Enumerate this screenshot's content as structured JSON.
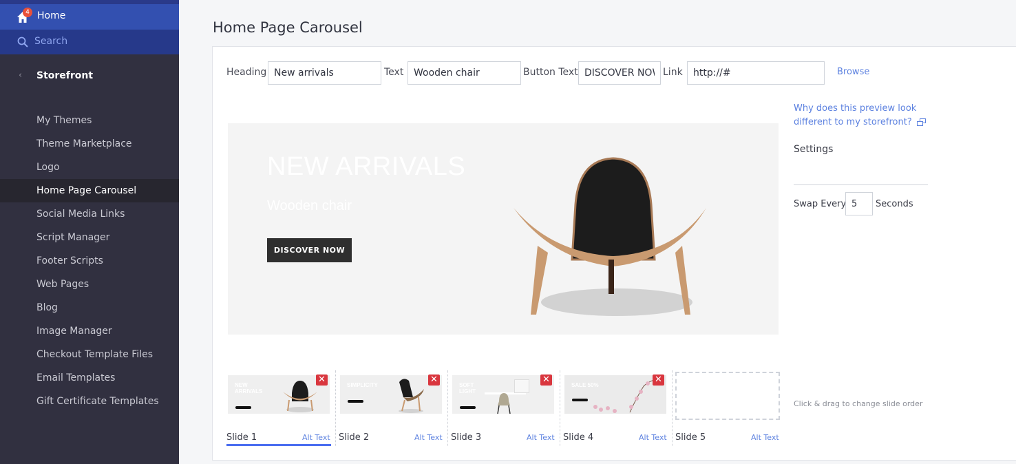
{
  "sidebar": {
    "home": {
      "label": "Home",
      "badge": "4",
      "icon": "home-icon"
    },
    "search": {
      "label": "Search",
      "icon": "search-icon"
    },
    "section": {
      "label": "Storefront",
      "icon": "chevron-left-icon"
    },
    "items": [
      {
        "label": "My Themes"
      },
      {
        "label": "Theme Marketplace"
      },
      {
        "label": "Logo"
      },
      {
        "label": "Home Page Carousel",
        "active": true
      },
      {
        "label": "Social Media Links"
      },
      {
        "label": "Script Manager"
      },
      {
        "label": "Footer Scripts"
      },
      {
        "label": "Web Pages"
      },
      {
        "label": "Blog"
      },
      {
        "label": "Image Manager"
      },
      {
        "label": "Checkout Template Files"
      },
      {
        "label": "Email Templates"
      },
      {
        "label": "Gift Certificate Templates"
      }
    ]
  },
  "page": {
    "title": "Home Page Carousel"
  },
  "form": {
    "heading_label": "Heading",
    "heading_value": "New arrivals",
    "text_label": "Text",
    "text_value": "Wooden chair",
    "button_text_label": "Button Text",
    "button_text_value": "DISCOVER NOW",
    "link_label": "Link",
    "link_value": "http://#",
    "browse_label": "Browse"
  },
  "preview": {
    "heading": "NEW ARRIVALS",
    "text": "Wooden chair",
    "button": "DISCOVER NOW",
    "image": "black shell chair with wooden legs"
  },
  "side_panel": {
    "help_link": "Why does this preview look different to my storefront?",
    "settings_title": "Settings",
    "swap_label": "Swap Every",
    "swap_value": "5",
    "seconds_label": "Seconds",
    "drag_hint": "Click & drag to change slide order"
  },
  "slides": [
    {
      "label": "Slide 1",
      "alt_text": "Alt Text",
      "thumb_title": "NEW ARRIVALS",
      "active": true,
      "empty": false
    },
    {
      "label": "Slide 2",
      "alt_text": "Alt Text",
      "thumb_title": "SIMPLICITY",
      "active": false,
      "empty": false
    },
    {
      "label": "Slide 3",
      "alt_text": "Alt Text",
      "thumb_title": "SOFT LIGHT",
      "active": false,
      "empty": false
    },
    {
      "label": "Slide 4",
      "alt_text": "Alt Text",
      "thumb_title": "SALE 50%",
      "active": false,
      "empty": false
    },
    {
      "label": "Slide 5",
      "alt_text": "Alt Text",
      "thumb_title": "",
      "active": false,
      "empty": true
    }
  ],
  "colors": {
    "accent": "#4b6ef0",
    "link": "#5d82e0",
    "sidebar_bg": "#313040",
    "home_bg": "#3350b0",
    "danger": "#d9363e"
  }
}
